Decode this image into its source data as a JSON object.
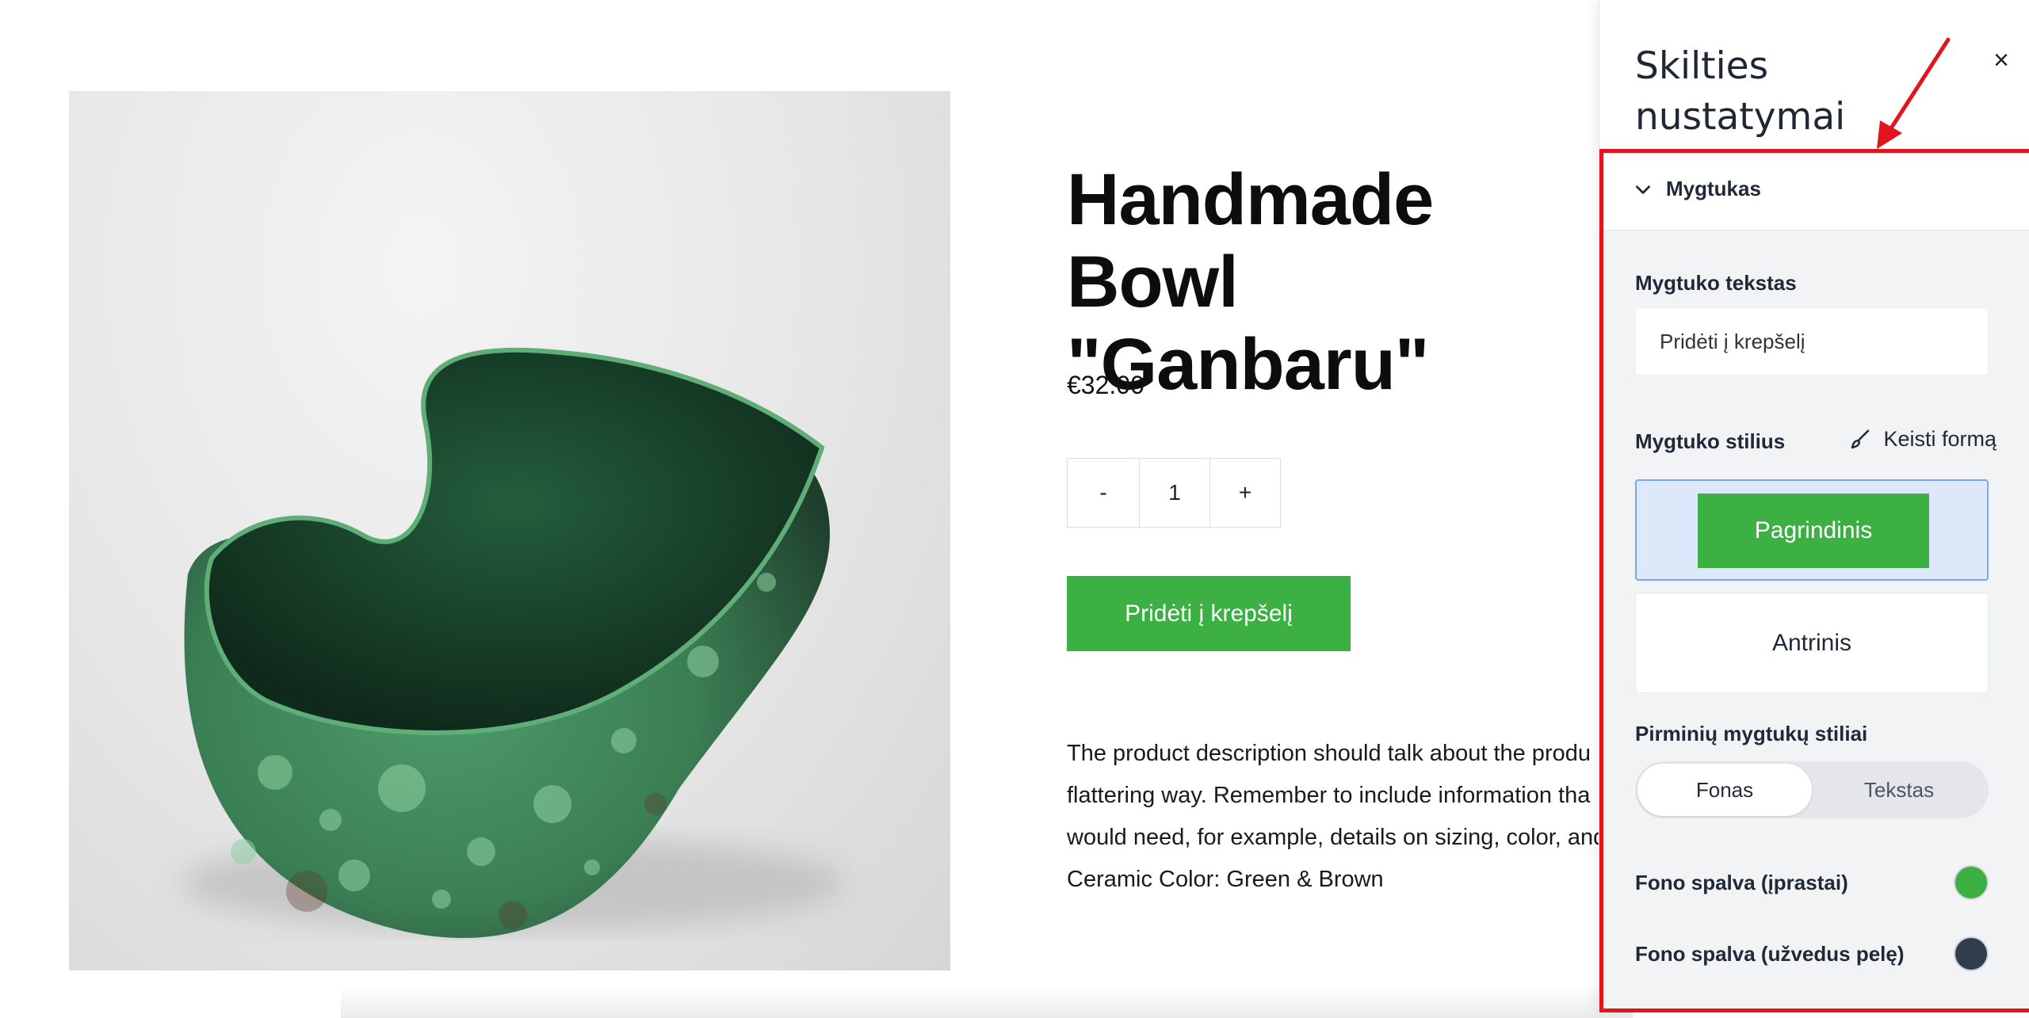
{
  "product": {
    "title": "Handmade Bowl\n\"Ganbaru\"",
    "price": "€32.00",
    "quantity": {
      "minus": "-",
      "value": "1",
      "plus": "+"
    },
    "add_to_cart": "Pridėti į krepšelį",
    "description": [
      "The product description should talk about the produ",
      "flattering way. Remember to include information tha",
      "would need, for example, details on sizing, color, and",
      "Ceramic Color: Green & Brown"
    ]
  },
  "panel": {
    "title": "Skilties nustatymai",
    "close_icon": "×",
    "section": "Mygtukas",
    "button_text_label": "Mygtuko tekstas",
    "button_text_value": "Pridėti į krepšelį",
    "button_style_label": "Mygtuko stilius",
    "edit_shape_label": "Keisti formą",
    "style_primary": "Pagrindinis",
    "style_secondary": "Antrinis",
    "primary_styles_label": "Pirminių mygtukų stiliai",
    "tabs": [
      "Fonas",
      "Tekstas"
    ],
    "bg_color_normal_label": "Fono spalva (įprastai)",
    "bg_color_hover_label": "Fono spalva (užvedus pelę)",
    "colors": {
      "normal": "#3cb043",
      "hover": "#2f3d4c"
    }
  },
  "theme": {
    "accent": "#3cb043",
    "annotation": "#e3141b"
  }
}
